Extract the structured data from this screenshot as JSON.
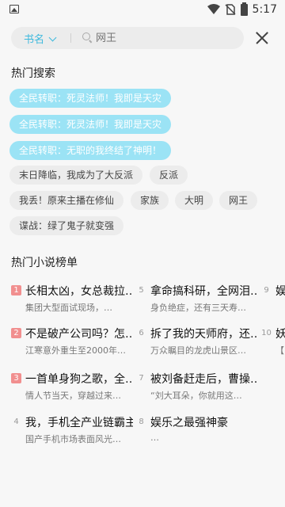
{
  "status_bar": {
    "time": "5:17"
  },
  "search": {
    "category": "书名",
    "placeholder": "网王"
  },
  "hot_search": {
    "title": "热门搜索",
    "tags": [
      {
        "label": "全民转职：死灵法师！我即是天灾",
        "style": "hot"
      },
      {
        "label": "全民转职：死灵法师！我即是天灾",
        "style": "hot"
      },
      {
        "label": "全民转职：无职的我终结了神明！",
        "style": "hot"
      },
      {
        "label": "末日降临，我成为了大反派",
        "style": "norm"
      },
      {
        "label": "反派",
        "style": "norm"
      },
      {
        "label": "我丢！原来主播在修仙",
        "style": "norm"
      },
      {
        "label": "家族",
        "style": "norm"
      },
      {
        "label": "大明",
        "style": "norm"
      },
      {
        "label": "网王",
        "style": "norm"
      },
      {
        "label": "谍战：绿了鬼子就变强",
        "style": "norm"
      }
    ]
  },
  "rank": {
    "title": "热门小说榜单",
    "items": [
      {
        "rank": "1",
        "title": "长相太凶，女总裁拉…",
        "desc": "集团大型面试现场，…"
      },
      {
        "rank": "2",
        "title": "不是破产公司吗？怎…",
        "desc": "江寒意外重生至2000年…"
      },
      {
        "rank": "3",
        "title": "一首单身狗之歌，全…",
        "desc": "情人节当天，穿越过来…"
      },
      {
        "rank": "4",
        "title": "我，手机全产业链霸主",
        "desc": "国产手机市场表面风光…"
      },
      {
        "rank": "5",
        "title": "拿命搞科研，全网泪…",
        "desc": "身负绝症，还有三天寿…"
      },
      {
        "rank": "6",
        "title": "拆了我的天师府，还…",
        "desc": "万众瞩目的龙虎山景区…"
      },
      {
        "rank": "7",
        "title": "被刘备赶走后，曹操…",
        "desc": "“刘大耳朵，你就用这…"
      },
      {
        "rank": "8",
        "title": "娱乐之最强神豪",
        "desc": "…"
      },
      {
        "rank": "9",
        "title": "娱",
        "desc": ""
      },
      {
        "rank": "10",
        "title": "妖",
        "desc": "【"
      }
    ]
  }
}
